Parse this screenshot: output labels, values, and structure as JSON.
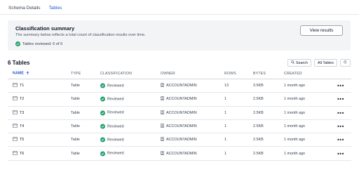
{
  "tabs": [
    {
      "label": "Schema Details",
      "active": false
    },
    {
      "label": "Tables",
      "active": true
    }
  ],
  "summary": {
    "title": "Classification summary",
    "description": "The summary below reflects a total count of classification results over time.",
    "tables_reviewed": "Tables reviewed: 6 of 6",
    "view_button": "View results"
  },
  "tables_section": {
    "count_label": "6 Tables",
    "search_label": "Search",
    "filter_label": "All Tables"
  },
  "columns": {
    "name": "NAME",
    "type": "TYPE",
    "classification": "CLASSIFICATION",
    "owner": "OWNER",
    "rows": "ROWS",
    "bytes": "BYTES",
    "created": "CREATED"
  },
  "rows": [
    {
      "name": "T1",
      "type": "Table",
      "classification": "Reviewed",
      "owner": "ACCOUNTADMIN",
      "rows": "13",
      "bytes": "3.5KB",
      "created": "1 month ago"
    },
    {
      "name": "T2",
      "type": "Table",
      "classification": "Reviewed",
      "owner": "ACCOUNTADMIN",
      "rows": "1",
      "bytes": "2.5KB",
      "created": "1 month ago"
    },
    {
      "name": "T3",
      "type": "Table",
      "classification": "Reviewed",
      "owner": "ACCOUNTADMIN",
      "rows": "1",
      "bytes": "2.5KB",
      "created": "1 month ago"
    },
    {
      "name": "T4",
      "type": "Table",
      "classification": "Reviewed",
      "owner": "ACCOUNTADMIN",
      "rows": "1",
      "bytes": "2.5KB",
      "created": "1 month ago"
    },
    {
      "name": "T5",
      "type": "Table",
      "classification": "Reviewed",
      "owner": "ACCOUNTADMIN",
      "rows": "1",
      "bytes": "2.5KB",
      "created": "1 month ago"
    },
    {
      "name": "T6",
      "type": "Table",
      "classification": "Reviewed",
      "owner": "ACCOUNTADMIN",
      "rows": "1",
      "bytes": "2.5KB",
      "created": "1 month ago"
    }
  ],
  "colors": {
    "accent": "#1a56db",
    "reviewed": "#22a06b"
  },
  "icons": {
    "table": "table-icon",
    "reviewed": "check-circle-icon",
    "owner": "role-icon",
    "more": "more-horizontal-icon",
    "search": "search-icon",
    "refresh": "refresh-icon",
    "sort": "sort-arrow-up-icon"
  }
}
